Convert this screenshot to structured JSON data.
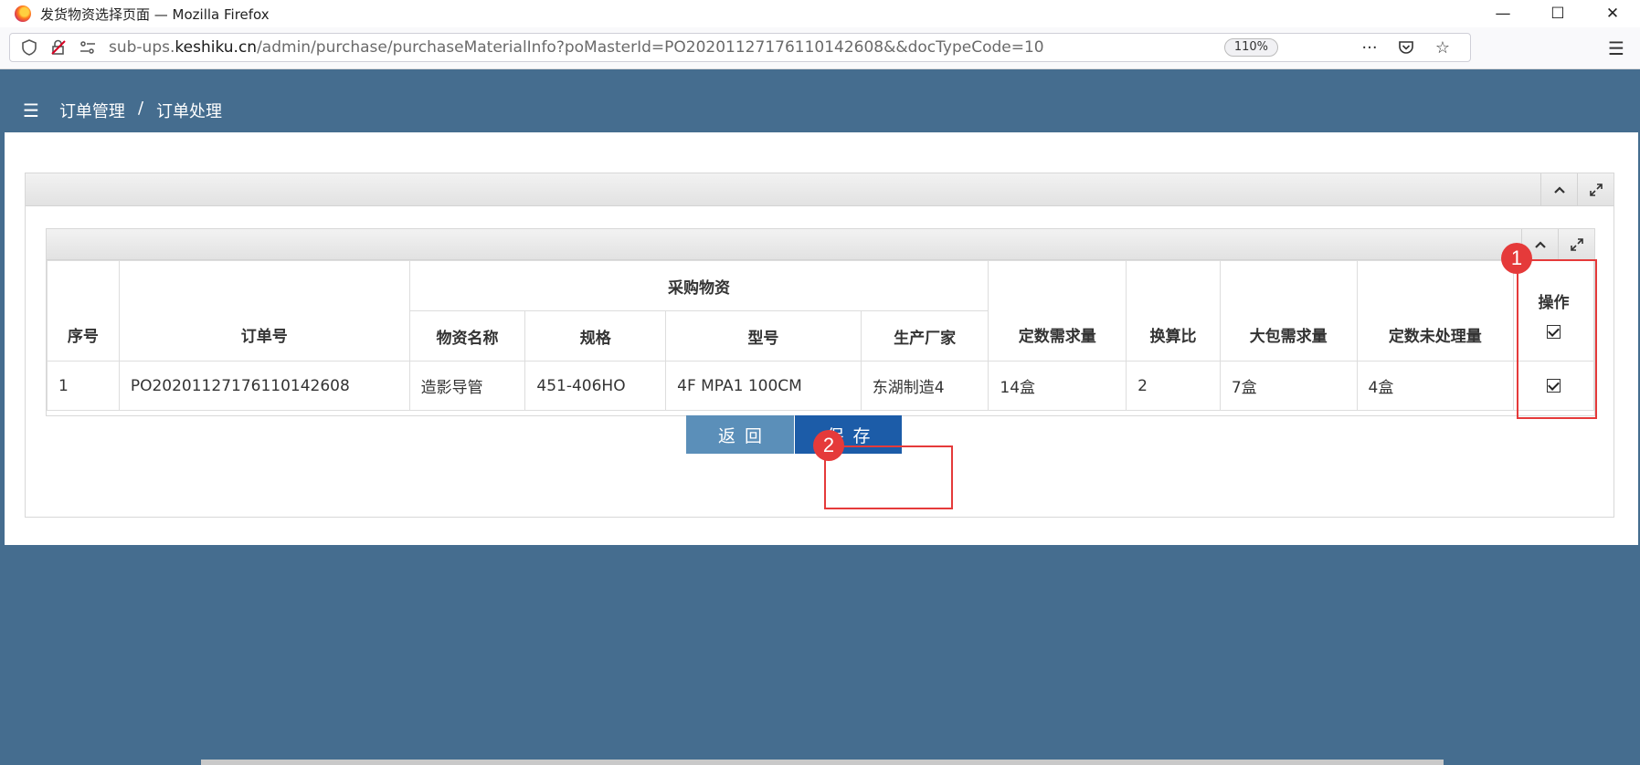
{
  "window": {
    "title": "发货物资选择页面 — Mozilla Firefox",
    "minimize": "—",
    "maximize": "☐",
    "close": "✕"
  },
  "address": {
    "url_prefix": "sub-ups.",
    "url_domain": "keshiku.cn",
    "url_path": "/admin/purchase/purchaseMaterialInfo?poMasterId=PO20201127176110142608&&docTypeCode=10",
    "zoom": "110%"
  },
  "header": {
    "crumb_1": "订单管理",
    "crumb_sep": "/",
    "crumb_2": "订单处理"
  },
  "table": {
    "headers": {
      "seq": "序号",
      "order_no": "订单号",
      "group": "采购物资",
      "material_name": "物资名称",
      "spec": "规格",
      "model": "型号",
      "manufacturer": "生产厂家",
      "fixed_demand": "定数需求量",
      "ratio": "换算比",
      "bulk_demand": "大包需求量",
      "fixed_unprocessed": "定数未处理量",
      "operation": "操作"
    },
    "rows": [
      {
        "seq": "1",
        "order_no": "PO20201127176110142608",
        "material_name": "造影导管",
        "spec": "451-406HO",
        "model": "4F MPA1 100CM",
        "manufacturer": "东湖制造4",
        "fixed_demand": "14盒",
        "ratio": "2",
        "bulk_demand": "7盒",
        "fixed_unprocessed": "4盒"
      }
    ]
  },
  "buttons": {
    "back": "返回",
    "save": "保存"
  },
  "annotations": {
    "badge_1": "1",
    "badge_2": "2"
  },
  "colors": {
    "header_bg": "#456d8f",
    "save_btn": "#1c5ca8",
    "back_btn": "#5b8fb9",
    "annotation": "#e53a3a"
  }
}
